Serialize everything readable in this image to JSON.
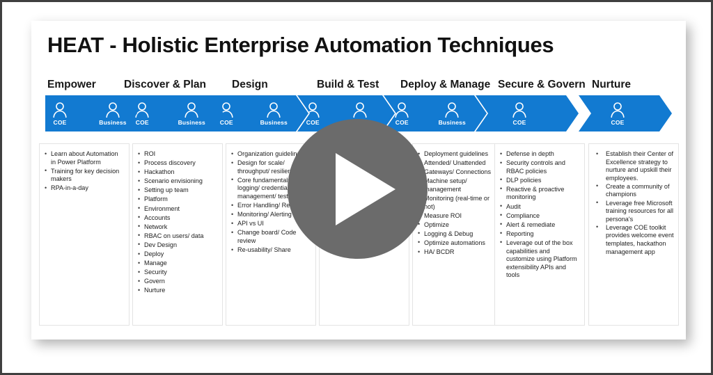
{
  "slide": {
    "title": "HEAT - Holistic Enterprise Automation Techniques",
    "accent_color": "#127ad1",
    "overlay_color": "#6b6b6b",
    "frame_color": "#3f3f3f"
  },
  "player": {
    "play_icon": "play-triangle-icon",
    "state": "paused"
  },
  "stages": [
    {
      "label": "Empower",
      "personas": [
        "COE",
        "Business"
      ],
      "bullets": [
        "Learn about Automation in Power Platform",
        "Training for key decision makers",
        "RPA-in-a-day"
      ]
    },
    {
      "label": "Discover & Plan",
      "personas": [
        "COE",
        "Business"
      ],
      "bullets": [
        "ROI",
        "Process discovery",
        "Hackathon",
        "Scenario envisioning",
        "Setting up team",
        "Platform",
        "Environment",
        "Accounts",
        "Network",
        "RBAC on users/ data",
        "Dev Design",
        "Deploy",
        "Manage",
        "Security",
        "Govern",
        "Nurture"
      ]
    },
    {
      "label": "Design",
      "personas": [
        "COE",
        "Business"
      ],
      "bullets": [
        "Organization guidelines",
        "Design for scale/ throughput/ resilient",
        "Core fundamentals: logging/ credential management/ test",
        "Error Handling/ Retry",
        "Monitoring/ Alerting",
        "API vs UI",
        "Change board/ Code review",
        "Re-usability/ Share"
      ]
    },
    {
      "label": "Build & Test",
      "personas": [
        "COE",
        "Business"
      ],
      "bullets": []
    },
    {
      "label": "Deploy & Manage",
      "personas": [
        "COE",
        "Business"
      ],
      "bullets": [
        "Deployment guidelines",
        "Attended/ Unattended",
        "Gateways/ Connections",
        "Machine setup/ management",
        "Monitoring (real-time or not)",
        "Measure ROI",
        "Optimize",
        "Logging & Debug",
        "Optimize automations",
        "HA/ BCDR"
      ]
    },
    {
      "label": "Secure & Govern",
      "personas": [
        "COE"
      ],
      "bullets": [
        "Defense in depth",
        "Security controls and RBAC policies",
        "DLP policies",
        "Reactive & proactive monitoring",
        "Audit",
        "Compliance",
        "Alert & remediate",
        "Reporting",
        "Leverage out of the box capabilities and customize using Platform extensibility APIs and tools"
      ]
    },
    {
      "label": "Nurture",
      "personas": [
        "COE"
      ],
      "bullets": [
        "Establish their Center of Excellence strategy to nurture and upskill their employees.",
        "Create a community of champions",
        "Leverage free Microsoft training resources for all persona's",
        "Leverage COE toolkit provides welcome event templates, hackathon management app"
      ]
    }
  ]
}
